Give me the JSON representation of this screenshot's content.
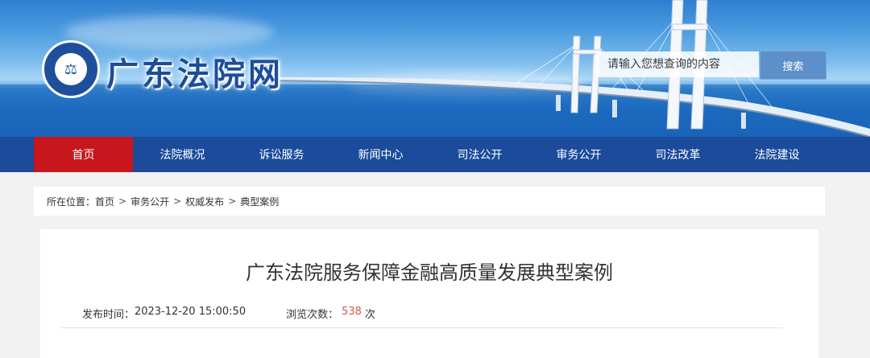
{
  "header": {
    "site_title": "广东法院网",
    "logo_icon": "court-emblem-icon",
    "search": {
      "placeholder": "请输入您想查询的内容",
      "button_label": "搜索"
    }
  },
  "nav": {
    "items": [
      {
        "label": "首页",
        "active": true
      },
      {
        "label": "法院概况",
        "active": false
      },
      {
        "label": "诉讼服务",
        "active": false
      },
      {
        "label": "新闻中心",
        "active": false
      },
      {
        "label": "司法公开",
        "active": false
      },
      {
        "label": "审务公开",
        "active": false
      },
      {
        "label": "司法改革",
        "active": false
      },
      {
        "label": "法院建设",
        "active": false
      }
    ],
    "active_color": "#c8161d",
    "bar_color": "#1b4b9a"
  },
  "breadcrumb": {
    "prefix": "所在位置：",
    "items": [
      "首页",
      "审务公开",
      "权威发布",
      "典型案例"
    ],
    "separator": ">"
  },
  "article": {
    "title": "广东法院服务保障金融高质量发展典型案例",
    "published_label": "发布时间：",
    "published_value": "2023-12-20 15:00:50",
    "views_label": "浏览次数：",
    "views_value": "538",
    "views_unit": "次"
  }
}
